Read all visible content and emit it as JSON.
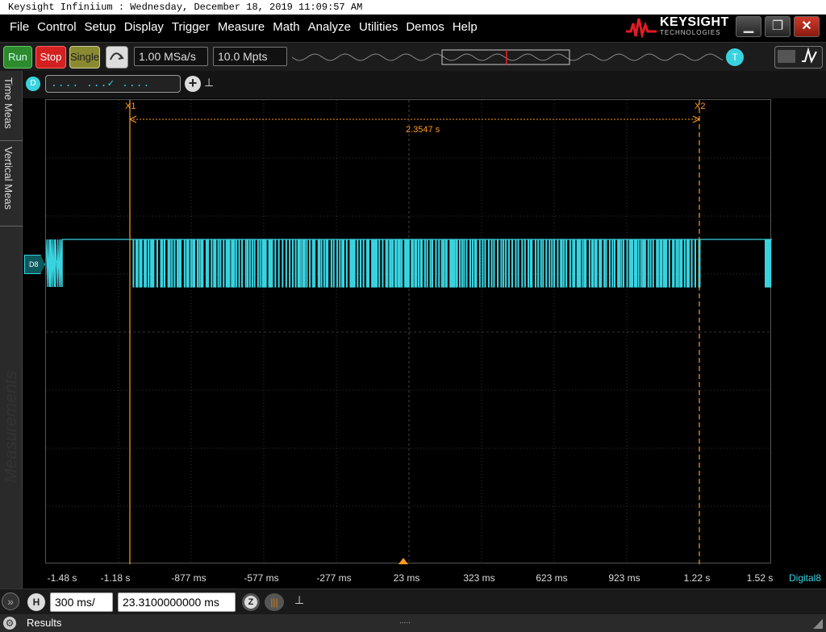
{
  "window": {
    "title": "Keysight Infiniium : Wednesday, December 18, 2019 11:09:57 AM"
  },
  "menu": [
    "File",
    "Control",
    "Setup",
    "Display",
    "Trigger",
    "Measure",
    "Math",
    "Analyze",
    "Utilities",
    "Demos",
    "Help"
  ],
  "brand": {
    "name": "KEYSIGHT",
    "sub": "TECHNOLOGIES"
  },
  "toolbar": {
    "run": "Run",
    "stop": "Stop",
    "single": "Single",
    "sample_rate": "1.00 MSa/s",
    "memory_depth": "10.0 Mpts",
    "trigger_badge": "T"
  },
  "digital": {
    "badge": "D",
    "pattern": ".... ...✓ .... ....",
    "add": "+"
  },
  "side_tabs": {
    "time_meas": "Time Meas",
    "vertical_meas": "Vertical Meas",
    "watermark": "Measurements"
  },
  "cursors": {
    "x1_label": "X1",
    "x2_label": "X2",
    "delta": "2.3547 s"
  },
  "channel": {
    "badge": "D8",
    "label": "D8",
    "name": "Digital8",
    "color": "#39d3e0"
  },
  "time_axis": [
    "-1.48 s",
    "-1.18 s",
    "-877 ms",
    "-577 ms",
    "-277 ms",
    "23 ms",
    "323 ms",
    "623 ms",
    "923 ms",
    "1.22 s",
    "1.52 s"
  ],
  "horizontal": {
    "badge": "H",
    "scale": "300 ms/",
    "position": "23.3100000000 ms",
    "zoom_badge": "Z"
  },
  "status": {
    "results": "Results",
    "dots": "....."
  },
  "colors": {
    "cursor": "#ff9a1f",
    "trace": "#39d3e0",
    "grid": "#444444"
  }
}
